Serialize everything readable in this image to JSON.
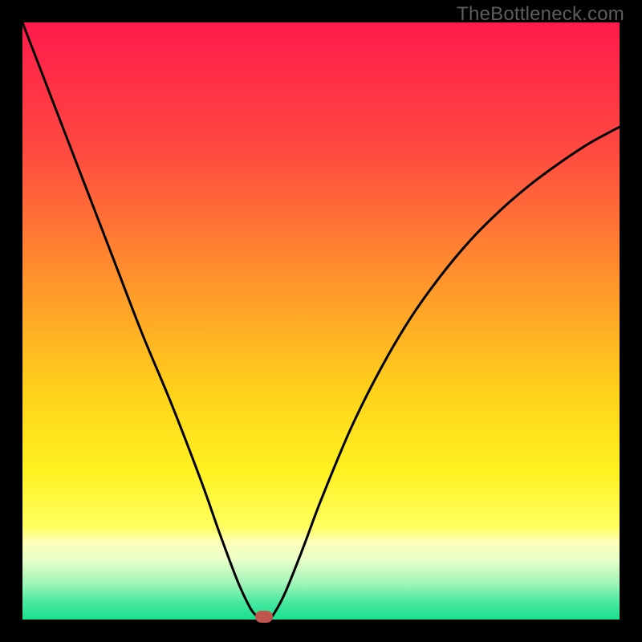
{
  "watermark": {
    "text": "TheBottleneck.com"
  },
  "chart_data": {
    "type": "line",
    "title": "",
    "xlabel": "",
    "ylabel": "",
    "xlim": [
      0,
      100
    ],
    "ylim": [
      0,
      100
    ],
    "grid": false,
    "legend": false,
    "background_gradient_stops": [
      {
        "pct": 0,
        "color": "#ff1a4b"
      },
      {
        "pct": 22,
        "color": "#ff4b40"
      },
      {
        "pct": 45,
        "color": "#ff9a2a"
      },
      {
        "pct": 62,
        "color": "#ffd21a"
      },
      {
        "pct": 75,
        "color": "#fff220"
      },
      {
        "pct": 84.5,
        "color": "#ffff60"
      },
      {
        "pct": 87,
        "color": "#feffb8"
      },
      {
        "pct": 90,
        "color": "#e8ffc8"
      },
      {
        "pct": 94,
        "color": "#a0f5b8"
      },
      {
        "pct": 97,
        "color": "#4be9a0"
      },
      {
        "pct": 100,
        "color": "#18df8f"
      }
    ],
    "series": [
      {
        "name": "bottleneck-curve",
        "color": "#000000",
        "x": [
          0,
          5,
          10,
          15,
          20,
          25,
          30,
          33,
          36,
          38,
          39,
          40,
          41,
          42,
          44,
          47,
          50,
          55,
          60,
          65,
          70,
          75,
          80,
          85,
          90,
          95,
          100
        ],
        "values": [
          100,
          87,
          74,
          61,
          48,
          36,
          23,
          14.5,
          6.5,
          2.2,
          0.8,
          0,
          0,
          0.8,
          4.5,
          12,
          20,
          32,
          42,
          50.5,
          57.5,
          63.5,
          68.5,
          72.8,
          76.5,
          79.8,
          82.5
        ]
      }
    ],
    "marker": {
      "x": 40.5,
      "y": 0,
      "color": "#c0554e"
    }
  }
}
